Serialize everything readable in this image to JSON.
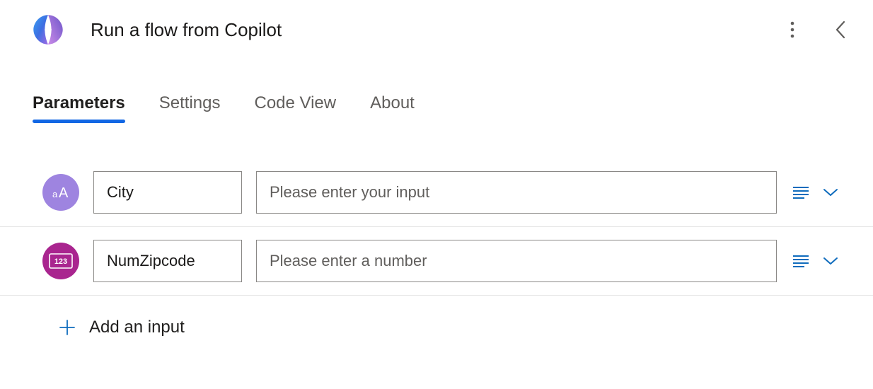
{
  "header": {
    "title": "Run a flow from Copilot"
  },
  "tabs": [
    {
      "key": "parameters",
      "label": "Parameters",
      "active": true
    },
    {
      "key": "settings",
      "label": "Settings",
      "active": false
    },
    {
      "key": "codeview",
      "label": "Code View",
      "active": false
    },
    {
      "key": "about",
      "label": "About",
      "active": false
    }
  ],
  "inputs": [
    {
      "type": "text",
      "type_icon": "aA",
      "name": "City",
      "value_placeholder": "Please enter your input",
      "value": ""
    },
    {
      "type": "number",
      "type_icon": "123",
      "name": "NumZipcode",
      "value_placeholder": "Please enter a number",
      "value": ""
    }
  ],
  "add_input_label": "Add an input",
  "colors": {
    "accent": "#0f6cbd",
    "tab_underline": "#1267e4",
    "text_badge": "#9e84e0",
    "number_badge": "#a9258f"
  }
}
